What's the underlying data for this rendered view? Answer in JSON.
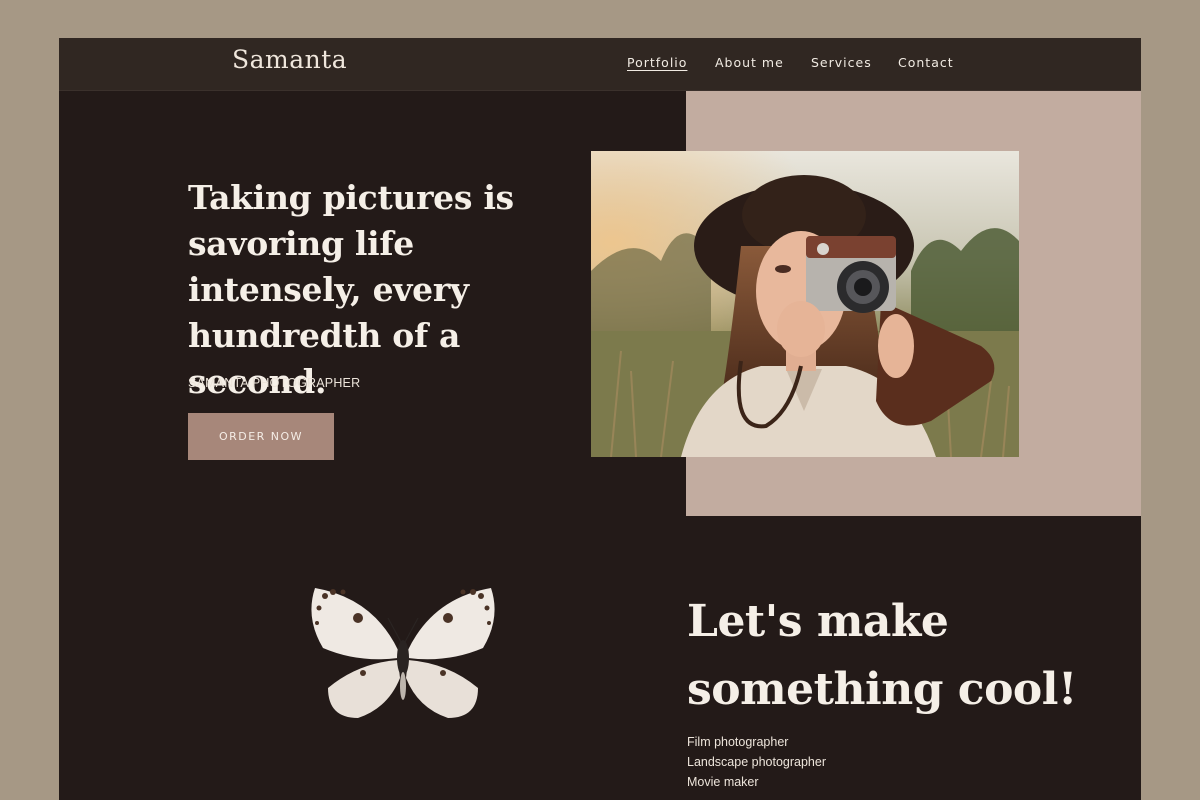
{
  "brand": {
    "logo": "Samanta"
  },
  "nav": [
    {
      "label": "Portfolio",
      "active": true
    },
    {
      "label": "About me",
      "active": false
    },
    {
      "label": "Services",
      "active": false
    },
    {
      "label": "Contact",
      "active": false
    }
  ],
  "hero": {
    "title": "Taking pictures is savoring life intensely, every hundredth of a second.",
    "subtitle": "SAMANTA PHOTOGRAPHER",
    "cta_label": "ORDER NOW",
    "image": "woman-with-camera-photo"
  },
  "section2": {
    "title": "Let's make something cool!",
    "decoration": "butterfly-image",
    "roles": [
      "Film photographer",
      "Landscape photographer",
      "Movie maker"
    ]
  },
  "colors": {
    "page_bg": "#a69885",
    "site_bg": "#231a18",
    "navbar_bg": "#302722",
    "accent_block": "#c2aca0",
    "button_bg": "#a7877a",
    "text_light": "#f5efe7"
  }
}
